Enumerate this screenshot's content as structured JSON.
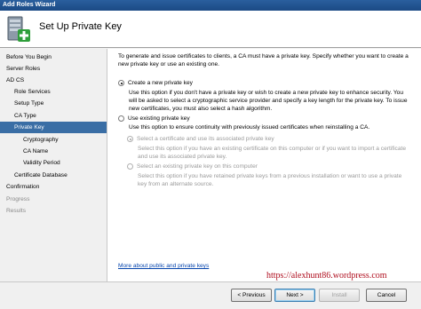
{
  "window": {
    "title": "Add Roles Wizard"
  },
  "header": {
    "title": "Set Up Private Key",
    "icon": "server-role-add-icon"
  },
  "sidebar": {
    "items": [
      {
        "label": "Before You Begin",
        "state": "normal"
      },
      {
        "label": "Server Roles",
        "state": "normal"
      },
      {
        "label": "AD CS",
        "state": "normal"
      },
      {
        "label": "Role Services",
        "state": "normal"
      },
      {
        "label": "Setup Type",
        "state": "normal"
      },
      {
        "label": "CA Type",
        "state": "normal"
      },
      {
        "label": "Private Key",
        "state": "selected"
      },
      {
        "label": "Cryptography",
        "state": "normal"
      },
      {
        "label": "CA Name",
        "state": "normal"
      },
      {
        "label": "Validity Period",
        "state": "normal"
      },
      {
        "label": "Certificate Database",
        "state": "normal"
      },
      {
        "label": "Confirmation",
        "state": "normal"
      },
      {
        "label": "Progress",
        "state": "disabled"
      },
      {
        "label": "Results",
        "state": "disabled"
      }
    ]
  },
  "main": {
    "intro": "To generate and issue certificates to clients, a CA must have a private key. Specify whether you want to create a new private key or use an existing one.",
    "options": {
      "create_new": {
        "label": "Create a new private key",
        "desc": "Use this option if you don't have a private key or wish to create a new private key to enhance security. You will be asked to select a cryptographic service provider and specify a key length for the private key. To issue new certificates, you must also select a hash algorithm."
      },
      "use_existing": {
        "label": "Use existing private key",
        "desc": "Use this option to ensure continuity with previously issued certificates when reinstalling a CA."
      },
      "select_cert": {
        "label": "Select a certificate and use its associated private key",
        "desc": "Select this option if you have an existing certificate on this computer or if you want to import a certificate and use its associated private key."
      },
      "select_key": {
        "label": "Select an existing private key on this computer",
        "desc": "Select this option if you have retained private keys from a previous installation or want to use a private key from an alternate source."
      }
    },
    "link": "More about public and private keys"
  },
  "footer": {
    "previous": "< Previous",
    "next": "Next >",
    "install": "Install",
    "cancel": "Cancel"
  },
  "watermark": "https://alexhunt86.wordpress.com"
}
